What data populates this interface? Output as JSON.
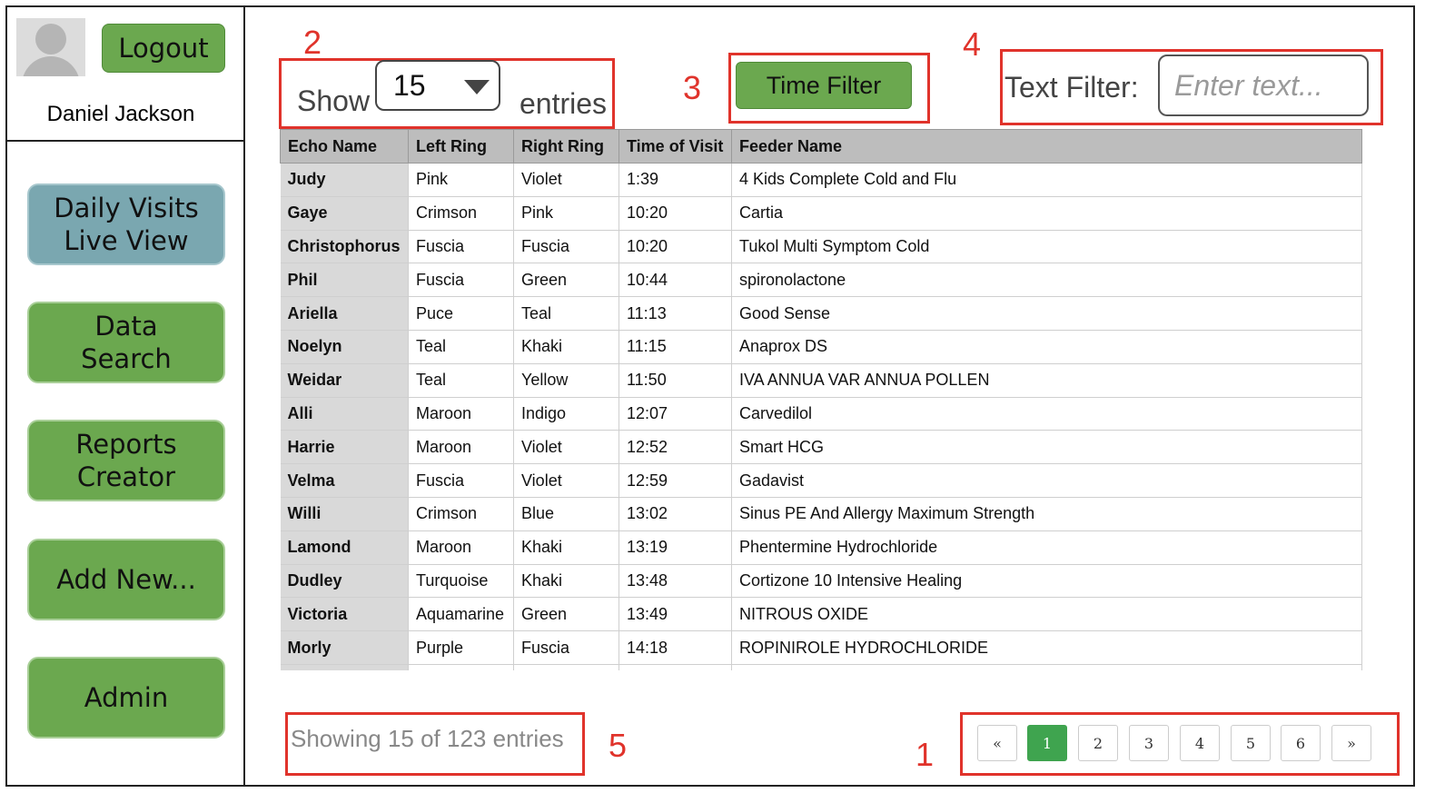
{
  "user": {
    "name": "Daniel Jackson",
    "logout_label": "Logout"
  },
  "sidebar": {
    "items": [
      {
        "label": "Daily Visits\nLive View",
        "active": true
      },
      {
        "label": "Data\nSearch"
      },
      {
        "label": "Reports\nCreator"
      },
      {
        "label": "Add New..."
      },
      {
        "label": "Admin"
      }
    ]
  },
  "controls": {
    "show_label": "Show",
    "entries_label": "entries",
    "entries_value": "15",
    "time_filter_label": "Time Filter",
    "text_filter_label": "Text Filter:",
    "text_filter_placeholder": "Enter text..."
  },
  "annotations": [
    "1",
    "2",
    "3",
    "4",
    "5"
  ],
  "table": {
    "headers": [
      "Echo Name",
      "Left Ring",
      "Right Ring",
      "Time of Visit",
      "Feeder Name"
    ],
    "rows": [
      [
        "Judy",
        "Pink",
        "Violet",
        "1:39",
        "4 Kids Complete Cold and Flu"
      ],
      [
        "Gaye",
        "Crimson",
        "Pink",
        "10:20",
        "Cartia"
      ],
      [
        "Christophorus",
        "Fuscia",
        "Fuscia",
        "10:20",
        "Tukol Multi Symptom Cold"
      ],
      [
        "Phil",
        "Fuscia",
        "Green",
        "10:44",
        "spironolactone"
      ],
      [
        "Ariella",
        "Puce",
        "Teal",
        "11:13",
        "Good Sense"
      ],
      [
        "Noelyn",
        "Teal",
        "Khaki",
        "11:15",
        "Anaprox DS"
      ],
      [
        "Weidar",
        "Teal",
        "Yellow",
        "11:50",
        "IVA ANNUA VAR ANNUA POLLEN"
      ],
      [
        "Alli",
        "Maroon",
        "Indigo",
        "12:07",
        "Carvedilol"
      ],
      [
        "Harrie",
        "Maroon",
        "Violet",
        "12:52",
        "Smart HCG"
      ],
      [
        "Velma",
        "Fuscia",
        "Violet",
        "12:59",
        "Gadavist"
      ],
      [
        "Willi",
        "Crimson",
        "Blue",
        "13:02",
        "Sinus PE And Allergy Maximum Strength"
      ],
      [
        "Lamond",
        "Maroon",
        "Khaki",
        "13:19",
        "Phentermine Hydrochloride"
      ],
      [
        "Dudley",
        "Turquoise",
        "Khaki",
        "13:48",
        "Cortizone 10 Intensive Healing"
      ],
      [
        "Victoria",
        "Aquamarine",
        "Green",
        "13:49",
        "NITROUS OXIDE"
      ],
      [
        "Morly",
        "Purple",
        "Fuscia",
        "14:18",
        "ROPINIROLE HYDROCHLORIDE"
      ],
      [
        "",
        "",
        "",
        "",
        ""
      ]
    ]
  },
  "footer": {
    "showing_text": "Showing 15 of 123 entries",
    "pages": [
      "«",
      "1",
      "2",
      "3",
      "4",
      "5",
      "6",
      "»"
    ],
    "active_page": "1"
  },
  "colors": {
    "button_green": "#6ba84f",
    "nav_active_blue": "#7aa7b0",
    "annotation_red": "#e0332b",
    "pager_active": "#3fa44f"
  }
}
